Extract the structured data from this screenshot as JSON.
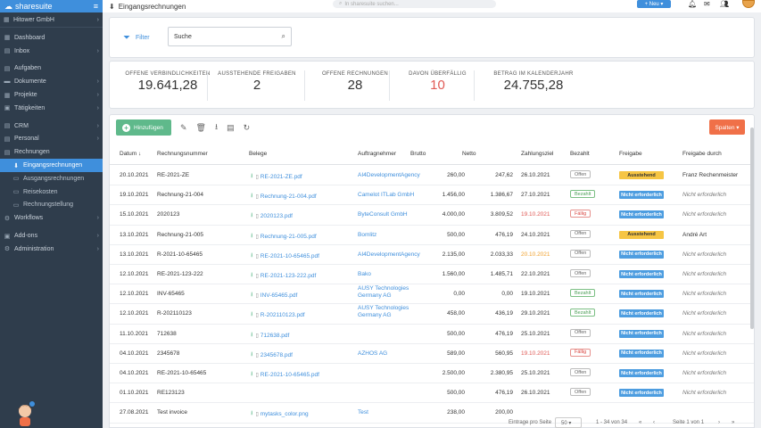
{
  "sidebar": {
    "brand": "sharesuite",
    "org": "Hitower GmbH",
    "items": [
      {
        "label": "Dashboard",
        "icon": "dashboard-icon",
        "glyph": "▦",
        "chev": false
      },
      {
        "label": "Inbox",
        "icon": "inbox-icon",
        "glyph": "▤",
        "chev": true
      },
      {
        "gap": true
      },
      {
        "label": "Aufgaben",
        "icon": "tasks-icon",
        "glyph": "▤",
        "chev": false
      },
      {
        "label": "Dokumente",
        "icon": "folder-icon",
        "glyph": "▬",
        "chev": true
      },
      {
        "label": "Projekte",
        "icon": "project-icon",
        "glyph": "▦",
        "chev": true
      },
      {
        "label": "Tätigkeiten",
        "icon": "clock-icon",
        "glyph": "▣",
        "chev": true
      },
      {
        "gap": true
      },
      {
        "label": "CRM",
        "icon": "crm-icon",
        "glyph": "▤",
        "chev": true
      },
      {
        "label": "Personal",
        "icon": "people-icon",
        "glyph": "▤",
        "chev": true
      },
      {
        "label": "Rechnungen",
        "icon": "invoice-icon",
        "glyph": "▤",
        "chev": false
      },
      {
        "label": "Eingangsrechnungen",
        "icon": "inbox-arrow-icon",
        "glyph": "⬇",
        "sub": true,
        "active": true
      },
      {
        "label": "Ausgangsrechnungen",
        "icon": "outbox-icon",
        "glyph": "▭",
        "sub": true
      },
      {
        "label": "Reisekosten",
        "icon": "travel-icon",
        "glyph": "▭",
        "sub": true
      },
      {
        "label": "Rechnungstellung",
        "icon": "billing-icon",
        "glyph": "▭",
        "sub": true
      },
      {
        "label": "Workflows",
        "icon": "workflow-icon",
        "glyph": "⚙",
        "chev": true
      },
      {
        "gap": true
      },
      {
        "label": "Add-ons",
        "icon": "addons-icon",
        "glyph": "▣",
        "chev": true
      },
      {
        "label": "Administration",
        "icon": "admin-icon",
        "glyph": "⚙",
        "chev": true
      }
    ]
  },
  "topbar": {
    "title": "Eingangsrechnungen",
    "search_placeholder": "In sharesuite suchen...",
    "new_label": "+ Neu ▾"
  },
  "filter": {
    "label": "Filter",
    "search_placeholder": "Suche"
  },
  "stats": [
    {
      "label": "OFFENE VERBINDLICHKEITEN",
      "value": "19.641,28",
      "red": false
    },
    {
      "label": "AUSSTEHENDE FREIGABEN",
      "value": "2",
      "red": false
    },
    {
      "label": "OFFENE RECHNUNGEN",
      "value": "28",
      "red": false
    },
    {
      "label": "DAVON ÜBERFÄLLIG",
      "value": "10",
      "red": true
    },
    {
      "label": "BETRAG IM KALENDERJAHR",
      "value": "24.755,28",
      "red": false
    }
  ],
  "toolbar": {
    "add_label": "Hinzufügen",
    "columns_label": "Spalten ▾"
  },
  "table": {
    "headers": [
      "Datum ↓",
      "Rechnungsnummer",
      "Belege",
      "Auftragnehmer",
      "Brutto",
      "Netto",
      "Zahlungsziel",
      "Bezahlt",
      "Freigabe",
      "Freigabe durch"
    ],
    "rows": [
      {
        "datum": "20.10.2021",
        "nr": "RE-2021-ZE",
        "beleg": "RE-2021-ZE.pdf",
        "auftr": "AI4DevelopmentAgency",
        "brutto": "260,00",
        "netto": "247,62",
        "ziel": "26.10.2021",
        "ziel_color": "",
        "bezahlt": "Offen",
        "bz": "gray",
        "freigabe": "Ausstehend",
        "fg": "yellow",
        "durch": "Franz Rechenmeister",
        "durch_it": false
      },
      {
        "datum": "19.10.2021",
        "nr": "Rechnung-21-004",
        "beleg": "Rechnung-21-004.pdf",
        "auftr": "Camelot ITLab GmbH",
        "brutto": "1.456,00",
        "netto": "1.386,67",
        "ziel": "27.10.2021",
        "ziel_color": "",
        "bezahlt": "Bezahlt",
        "bz": "green",
        "freigabe": "Nicht erforderlich",
        "fg": "blue",
        "durch": "Nicht erforderlich",
        "durch_it": true
      },
      {
        "datum": "15.10.2021",
        "nr": "2020123",
        "beleg": "2020123.pdf",
        "auftr": "ByteConsult GmbH",
        "brutto": "4.000,00",
        "netto": "3.809,52",
        "ziel": "19.10.2021",
        "ziel_color": "red",
        "bezahlt": "Fällig",
        "bz": "red",
        "freigabe": "Nicht erforderlich",
        "fg": "blue",
        "durch": "Nicht erforderlich",
        "durch_it": true
      },
      {
        "datum": "13.10.2021",
        "nr": "Rechnung-21-005",
        "beleg": "Rechnung-21-005.pdf",
        "auftr": "Bomlitz",
        "brutto": "500,00",
        "netto": "476,19",
        "ziel": "24.10.2021",
        "ziel_color": "",
        "bezahlt": "Offen",
        "bz": "gray",
        "freigabe": "Ausstehend",
        "fg": "yellow",
        "durch": "André Art",
        "durch_it": false
      },
      {
        "datum": "13.10.2021",
        "nr": "R-2021-10-65465",
        "beleg": "RE-2021-10-65465.pdf",
        "auftr": "AI4DevelopmentAgency",
        "brutto": "2.135,00",
        "netto": "2.033,33",
        "ziel": "20.10.2021",
        "ziel_color": "orange",
        "bezahlt": "Offen",
        "bz": "gray",
        "freigabe": "Nicht erforderlich",
        "fg": "blue",
        "durch": "Nicht erforderlich",
        "durch_it": true
      },
      {
        "datum": "12.10.2021",
        "nr": "RE-2021-123-222",
        "beleg": "RE-2021-123-222.pdf",
        "auftr": "Bako",
        "brutto": "1.560,00",
        "netto": "1.485,71",
        "ziel": "22.10.2021",
        "ziel_color": "",
        "bezahlt": "Offen",
        "bz": "gray",
        "freigabe": "Nicht erforderlich",
        "fg": "blue",
        "durch": "Nicht erforderlich",
        "durch_it": true
      },
      {
        "datum": "12.10.2021",
        "nr": "INV-65465",
        "beleg": "INV-65465.pdf",
        "auftr": "AUSY Technologies Germany AG",
        "brutto": "0,00",
        "netto": "0,00",
        "ziel": "19.10.2021",
        "ziel_color": "",
        "bezahlt": "Bezahlt",
        "bz": "green",
        "freigabe": "Nicht erforderlich",
        "fg": "blue",
        "durch": "Nicht erforderlich",
        "durch_it": true
      },
      {
        "datum": "12.10.2021",
        "nr": "R-202110123",
        "beleg": "R-202110123.pdf",
        "auftr": "AUSY Technologies Germany AG",
        "brutto": "458,00",
        "netto": "436,19",
        "ziel": "29.10.2021",
        "ziel_color": "",
        "bezahlt": "Bezahlt",
        "bz": "green",
        "freigabe": "Nicht erforderlich",
        "fg": "blue",
        "durch": "Nicht erforderlich",
        "durch_it": true
      },
      {
        "datum": "11.10.2021",
        "nr": "712638",
        "beleg": "712638.pdf",
        "auftr": "",
        "brutto": "500,00",
        "netto": "476,19",
        "ziel": "25.10.2021",
        "ziel_color": "",
        "bezahlt": "Offen",
        "bz": "gray",
        "freigabe": "Nicht erforderlich",
        "fg": "blue",
        "durch": "Nicht erforderlich",
        "durch_it": true
      },
      {
        "datum": "04.10.2021",
        "nr": "2345678",
        "beleg": "2345678.pdf",
        "auftr": "AZHOS AG",
        "brutto": "589,00",
        "netto": "560,95",
        "ziel": "19.10.2021",
        "ziel_color": "red",
        "bezahlt": "Fällig",
        "bz": "red",
        "freigabe": "Nicht erforderlich",
        "fg": "blue",
        "durch": "Nicht erforderlich",
        "durch_it": true
      },
      {
        "datum": "04.10.2021",
        "nr": "RE-2021-10-65465",
        "beleg": "RE-2021-10-65465.pdf",
        "auftr": "",
        "brutto": "2.500,00",
        "netto": "2.380,95",
        "ziel": "25.10.2021",
        "ziel_color": "",
        "bezahlt": "Offen",
        "bz": "gray",
        "freigabe": "Nicht erforderlich",
        "fg": "blue",
        "durch": "Nicht erforderlich",
        "durch_it": true
      },
      {
        "datum": "01.10.2021",
        "nr": "RE123123",
        "beleg": "",
        "auftr": "",
        "brutto": "500,00",
        "netto": "476,19",
        "ziel": "26.10.2021",
        "ziel_color": "",
        "bezahlt": "Offen",
        "bz": "gray",
        "freigabe": "Nicht erforderlich",
        "fg": "blue",
        "durch": "Nicht erforderlich",
        "durch_it": true
      },
      {
        "datum": "27.08.2021",
        "nr": "Test invoice",
        "beleg": "mytasks_color.png",
        "auftr": "Test",
        "brutto": "238,00",
        "netto": "200,00",
        "ziel": "",
        "ziel_color": "",
        "bezahlt": "",
        "bz": "",
        "freigabe": "",
        "fg": "",
        "durch": "",
        "durch_it": false
      }
    ]
  },
  "pager": {
    "per_page_label": "Eintrage pro Seite",
    "per_page_value": "50 ▾",
    "range": "1 - 34 von 34",
    "page": "Seite 1 von 1",
    "first": "«",
    "prev": "‹",
    "next": "›",
    "last": "»"
  }
}
